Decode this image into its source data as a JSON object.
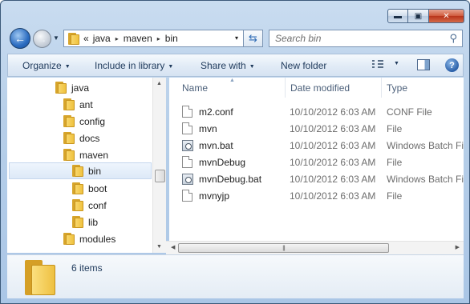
{
  "window": {
    "caption": {
      "minimize": "▬",
      "maximize": "▣",
      "close": "✕"
    }
  },
  "address_bar": {
    "overflow": "«",
    "crumbs": [
      "java",
      "maven",
      "bin"
    ],
    "separator": "▸",
    "dropdown": "▾"
  },
  "refresh_glyph": "⇆",
  "search": {
    "placeholder": "Search bin",
    "icon": "search-icon"
  },
  "toolbar": {
    "organize": "Organize",
    "include_in_library": "Include in library",
    "share_with": "Share with",
    "new_folder": "New folder",
    "dropdown_glyph": "▼",
    "help": "?"
  },
  "nav_tree": [
    {
      "label": "java",
      "level": 0
    },
    {
      "label": "ant",
      "level": 1
    },
    {
      "label": "config",
      "level": 1
    },
    {
      "label": "docs",
      "level": 1
    },
    {
      "label": "maven",
      "level": 1
    },
    {
      "label": "bin",
      "level": 2,
      "selected": true
    },
    {
      "label": "boot",
      "level": 2
    },
    {
      "label": "conf",
      "level": 2
    },
    {
      "label": "lib",
      "level": 2
    },
    {
      "label": "modules",
      "level": 1
    }
  ],
  "columns": {
    "name": "Name",
    "date_modified": "Date modified",
    "type": "Type"
  },
  "files": [
    {
      "name": "m2.conf",
      "date": "10/10/2012 6:03 AM",
      "type": "CONF File",
      "icon": "file-icon"
    },
    {
      "name": "mvn",
      "date": "10/10/2012 6:03 AM",
      "type": "File",
      "icon": "file-icon"
    },
    {
      "name": "mvn.bat",
      "date": "10/10/2012 6:03 AM",
      "type": "Windows Batch File",
      "icon": "batch-file-icon"
    },
    {
      "name": "mvnDebug",
      "date": "10/10/2012 6:03 AM",
      "type": "File",
      "icon": "file-icon"
    },
    {
      "name": "mvnDebug.bat",
      "date": "10/10/2012 6:03 AM",
      "type": "Windows Batch File",
      "icon": "batch-file-icon"
    },
    {
      "name": "mvnyjp",
      "date": "10/10/2012 6:03 AM",
      "type": "File",
      "icon": "file-icon"
    }
  ],
  "details": {
    "item_count": "6 items"
  },
  "colors": {
    "accent": "#1e395b",
    "selection": "#dde9f7",
    "folder": "#efc23f"
  }
}
